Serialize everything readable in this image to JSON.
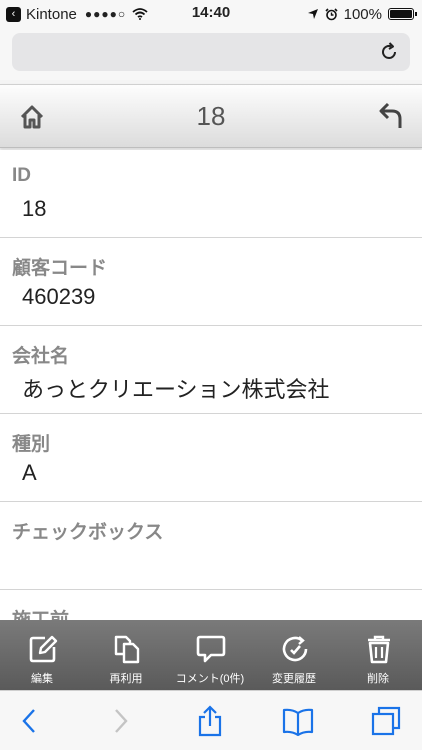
{
  "status_bar": {
    "carrier": "Kintone",
    "signal": "●●●●○",
    "time": "14:40",
    "battery": "100%",
    "battery_level": 1.0
  },
  "app_header": {
    "title": "18"
  },
  "fields": [
    {
      "label": "ID",
      "value": "18"
    },
    {
      "label": "顧客コード",
      "value": "460239"
    },
    {
      "label": "会社名",
      "value": "あっとクリエーション株式会社"
    },
    {
      "label": "種別",
      "value": "A"
    },
    {
      "label": "チェックボックス",
      "value": ""
    },
    {
      "label": "施工前",
      "value": ""
    }
  ],
  "actions": [
    {
      "label": "編集",
      "icon": "edit-icon"
    },
    {
      "label": "再利用",
      "icon": "copy-icon"
    },
    {
      "label": "コメント(0件)",
      "icon": "comment-icon"
    },
    {
      "label": "変更履歴",
      "icon": "history-icon"
    },
    {
      "label": "削除",
      "icon": "trash-icon"
    }
  ],
  "browser_toolbar": {
    "icons": [
      "back-arrow-icon",
      "forward-arrow-icon",
      "share-icon",
      "bookmarks-icon",
      "tabs-icon"
    ]
  },
  "colors": {
    "action_bar": "#666666",
    "ios_blue": "#1a73e8",
    "label_gray": "#888888"
  }
}
